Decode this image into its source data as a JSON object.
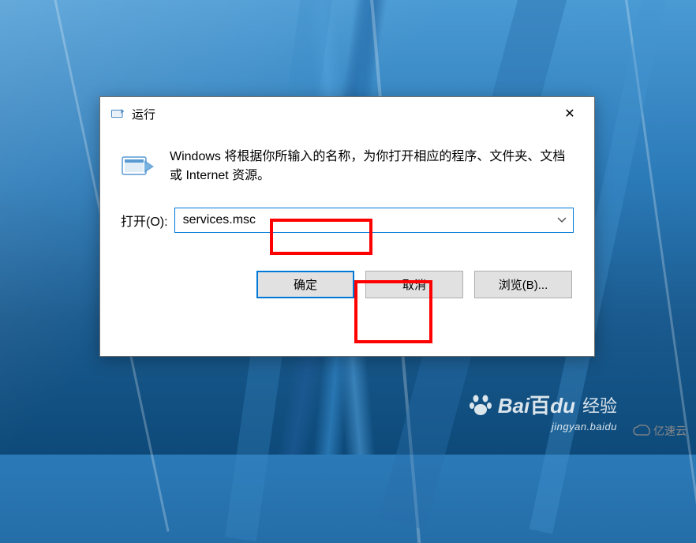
{
  "dialog": {
    "title": "运行",
    "description": "Windows 将根据你所输入的名称，为你打开相应的程序、文件夹、文档或 Internet 资源。",
    "input_label": "打开(O):",
    "input_value": "services.msc",
    "buttons": {
      "ok": "确定",
      "cancel": "取消",
      "browse": "浏览(B)..."
    }
  },
  "watermarks": {
    "baidu_brand": "Baidu",
    "baidu_product": "经验",
    "baidu_url": "jingyan.baidu",
    "yisu": "亿速云"
  }
}
